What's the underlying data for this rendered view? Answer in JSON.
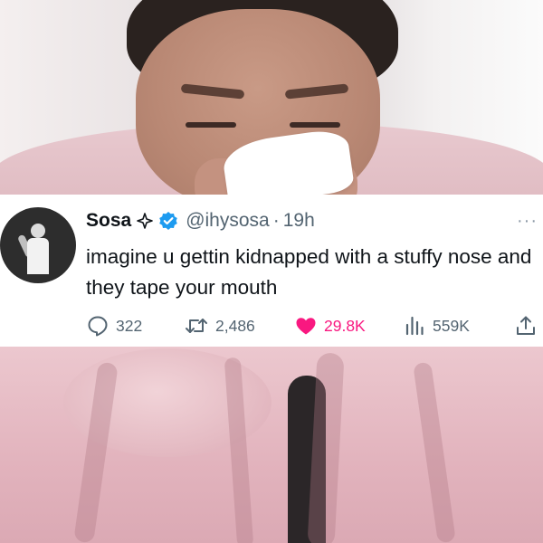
{
  "tweet": {
    "display_name": "Sosa",
    "handle": "@ihysosa",
    "separator": "·",
    "timestamp": "19h",
    "more_label": "···",
    "text": "imagine u gettin kidnapped with a stuffy nose and they tape your mouth",
    "metrics": {
      "replies": "322",
      "retweets": "2,486",
      "likes": "29.8K",
      "views": "559K"
    }
  },
  "colors": {
    "like_active": "#f91880",
    "verified_badge": "#1d9bf0",
    "secondary_text": "#536471"
  },
  "icons": [
    "sparkle-icon",
    "verified-badge-icon",
    "more-icon",
    "reply-icon",
    "retweet-icon",
    "like-icon",
    "views-icon",
    "share-icon"
  ]
}
